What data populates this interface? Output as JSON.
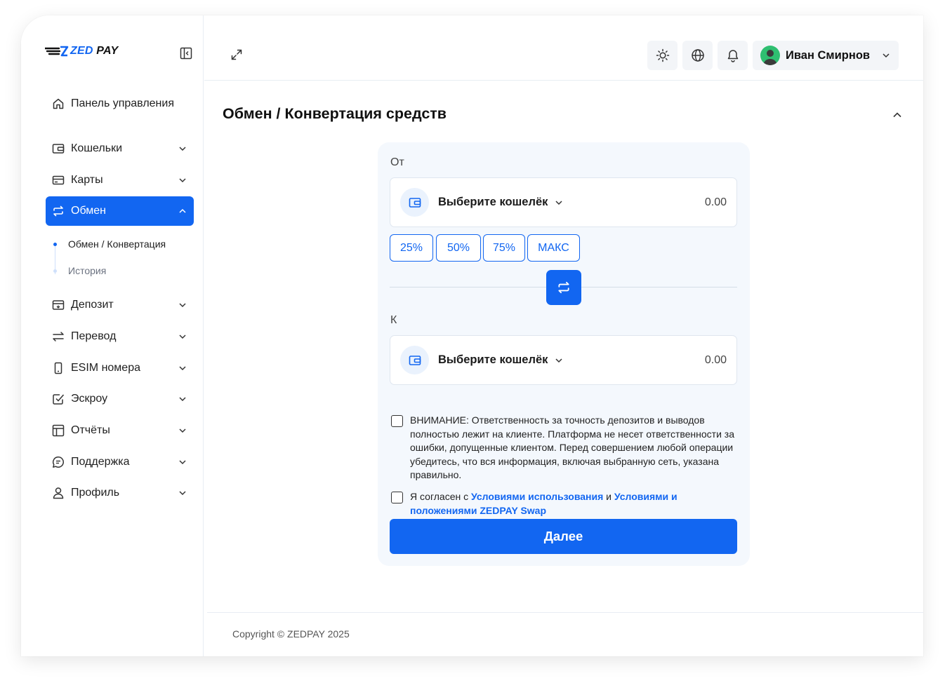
{
  "brand": {
    "logo_text_zed": "ZED",
    "logo_text_pay": " PAY",
    "accent": "#1266f1"
  },
  "sidebar": {
    "dashboard": "Панель управления",
    "items": [
      {
        "label": "Кошельки",
        "icon": "wallet-icon"
      },
      {
        "label": "Карты",
        "icon": "card-icon"
      },
      {
        "label": "Обмен",
        "icon": "exchange-icon",
        "active": true
      },
      {
        "label": "Депозит",
        "icon": "deposit-icon"
      },
      {
        "label": "Перевод",
        "icon": "transfer-icon"
      },
      {
        "label": "ESIM номера",
        "icon": "phone-icon"
      },
      {
        "label": "Эскроу",
        "icon": "checkbox-icon"
      },
      {
        "label": "Отчёты",
        "icon": "report-icon"
      },
      {
        "label": "Поддержка",
        "icon": "chat-icon"
      },
      {
        "label": "Профиль",
        "icon": "user-icon"
      }
    ],
    "exchange_sub": [
      "Обмен / Конвертация",
      "История"
    ]
  },
  "topbar": {
    "user_name": "Иван Смирнов"
  },
  "main": {
    "title": "Обмен / Конвертация средств",
    "from_label": "От",
    "to_label": "К",
    "wallet_placeholder": "Выберите кошелёк",
    "from_amount": "0.00",
    "to_amount": "0.00",
    "percents": [
      "25%",
      "50%",
      "75%",
      "МАКС"
    ],
    "warning": "ВНИМАНИЕ: Ответственность за точность депозитов и выводов полностью лежит на клиенте. Платформа не несет ответственности за ошибки, допущенные клиентом. Перед совершением любой операции убедитесь, что вся информация, включая выбранную сеть, указана правильно.",
    "agree_prefix": "Я согласен с ",
    "agree_link1": "Условиями использования",
    "agree_middle": " и ",
    "agree_link2": "Условиями и положениями ZEDPAY Swap",
    "next_button": "Далее"
  },
  "footer": {
    "copyright": "Copyright © ZEDPAY 2025"
  }
}
